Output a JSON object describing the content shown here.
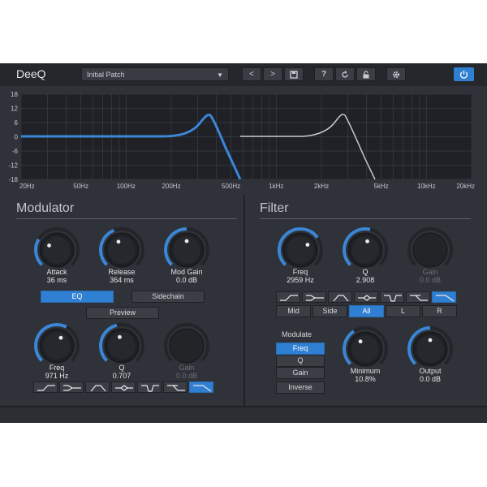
{
  "app": {
    "title": "DeeQ",
    "patch": "Initial Patch"
  },
  "toolbar": {
    "prev": "<",
    "next": ">",
    "save_icon": "save-icon",
    "help": "?",
    "reload_icon": "refresh-icon",
    "lock_icon": "lock-icon",
    "settings_icon": "gear-icon",
    "power_icon": "power-icon"
  },
  "graph": {
    "y_ticks": [
      "18",
      "12",
      "6",
      "0",
      "-6",
      "-12",
      "-18"
    ],
    "x_ticks": [
      "20Hz",
      "50Hz",
      "100Hz",
      "200Hz",
      "500Hz",
      "1kHz",
      "2kHz",
      "5kHz",
      "10kHz",
      "20kHz"
    ],
    "colors": {
      "modulator": "#3b86d6",
      "filter": "#c6c8cc"
    }
  },
  "modulator": {
    "title": "Modulator",
    "knobs": [
      {
        "name": "Attack",
        "value": "36 ms",
        "level": 0.28
      },
      {
        "name": "Release",
        "value": "364 ms",
        "level": 0.42
      },
      {
        "name": "Mod Gain",
        "value": "0.0 dB",
        "level": 0.5
      }
    ],
    "mode_buttons": [
      "EQ",
      "Sidechain"
    ],
    "active_mode": "EQ",
    "preview": "Preview",
    "eq_knobs": [
      {
        "name": "Freq",
        "value": "971 Hz",
        "level": 0.6
      },
      {
        "name": "Q",
        "value": "0.707",
        "level": 0.45
      },
      {
        "name": "Gain",
        "value": "0.0 dB",
        "level": 0.0,
        "disabled": true
      }
    ],
    "filter_types": [
      "low-shelf",
      "bell-cut",
      "band-pass",
      "notch",
      "band-reject",
      "high-shelf",
      "low-pass"
    ],
    "active_filter_type": "low-pass"
  },
  "filter": {
    "title": "Filter",
    "knobs": [
      {
        "name": "Freq",
        "value": "2959 Hz",
        "level": 0.7
      },
      {
        "name": "Q",
        "value": "2.908",
        "level": 0.55
      },
      {
        "name": "Gain",
        "value": "0.0 dB",
        "level": 0.0,
        "disabled": true
      }
    ],
    "filter_types": [
      "low-shelf",
      "bell-cut",
      "band-pass",
      "notch",
      "band-reject",
      "high-shelf",
      "low-pass"
    ],
    "active_filter_type": "low-pass",
    "channels": [
      "Mid",
      "Side",
      "All",
      "L",
      "R"
    ],
    "active_channel": "All",
    "modulate_label": "Modulate",
    "modulate_options": [
      "Freq",
      "Q",
      "Gain"
    ],
    "active_modulate": "Freq",
    "inverse": "Inverse",
    "range_knobs": [
      {
        "name": "Minimum",
        "value": "10.8%",
        "level": 0.38
      },
      {
        "name": "Output",
        "value": "0.0 dB",
        "level": 0.5
      }
    ]
  }
}
